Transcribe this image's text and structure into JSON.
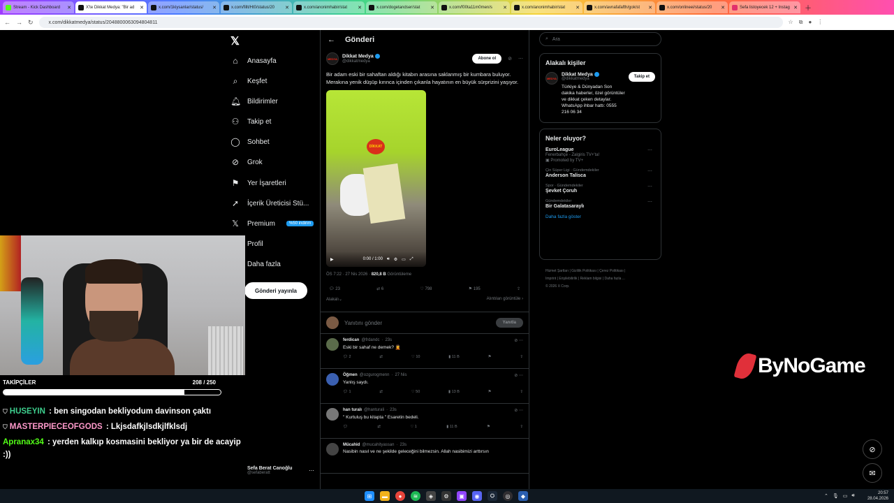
{
  "browser": {
    "tabs": [
      {
        "label": "Stream - Kick Dashboard",
        "color": "#53fc18"
      },
      {
        "label": "X'te Dikkat Medya: \"Bir ad",
        "color": "#111111"
      },
      {
        "label": "x.com/1kiysanlar/status/",
        "color": "#111111"
      },
      {
        "label": "x.com/fillt/Ht0/status/20",
        "color": "#111111"
      },
      {
        "label": "x.com/anonimhabir/stat",
        "color": "#111111"
      },
      {
        "label": "x.com/dogetandser/stat",
        "color": "#111111"
      },
      {
        "label": "x.com/f00ta11m0men/s",
        "color": "#111111"
      },
      {
        "label": "x.com/anonimhabir/stat",
        "color": "#111111"
      },
      {
        "label": "x.com/avnafafafth/gok/st",
        "color": "#111111"
      },
      {
        "label": "x.com/onlineei/status/20",
        "color": "#111111"
      },
      {
        "label": "Sefa listoyecek 12 + Instag",
        "color": "#e1306c"
      }
    ],
    "url": "x.com/dikkatmedya/status/2048800063094804811"
  },
  "nav": {
    "items": [
      {
        "label": "Anasayfa",
        "icon": "home-icon"
      },
      {
        "label": "Keşfet",
        "icon": "search-icon"
      },
      {
        "label": "Bildirimler",
        "icon": "bell-icon"
      },
      {
        "label": "Takip et",
        "icon": "person-plus-icon"
      },
      {
        "label": "Sohbet",
        "icon": "chat-icon"
      },
      {
        "label": "Grok",
        "icon": "grok-icon"
      },
      {
        "label": "Yer İşaretleri",
        "icon": "bookmark-icon"
      },
      {
        "label": "İçerik Üreticisi Stü...",
        "icon": "rocket-icon"
      },
      {
        "label": "Premium",
        "icon": "x-icon"
      },
      {
        "label": "Profil",
        "icon": "person-icon"
      },
      {
        "label": "Daha fazla",
        "icon": "more-icon"
      }
    ],
    "premium_badge": "%50 indirim",
    "post_button": "Gönderi yayınla",
    "profile": {
      "name": "Sefa Berat Canoğlu",
      "handle": "@sefaberatt"
    }
  },
  "main": {
    "title": "Gönderi",
    "post": {
      "author_name": "Dikkat Medya",
      "author_handle": "@dikkatmedya",
      "subscribe": "Abone ol",
      "text": "Bir adam eski bir sahaftan aldığı kitabın arasına saklanmış bir kumbara buluyor. Merakına yenik düşüp kırınca içinden çıkanla hayatının en büyük sürprizini yaşıyor.",
      "video_time": "0:00 / 1:00",
      "meta_time": "ÖS 7:22 · 27 Nis 2026 · ",
      "views": "820,8 B",
      "views_label": "Görüntüleme",
      "stats": {
        "replies": "23",
        "reposts": "6",
        "likes": "798",
        "bookmarks": "195"
      },
      "relevant_label": "Alakalı",
      "quotes_label": "Alıntıları görüntüle"
    },
    "reply_placeholder": "Yanıtını gönder",
    "reply_button": "Yanıtla",
    "comments": [
      {
        "name": "ferdican",
        "handle": "@frdandc",
        "time": "23s",
        "text": "Eski bir sahaf ne demek? 🤦",
        "replies": "2",
        "reposts": "",
        "likes": "10",
        "views": "11 B",
        "avatar_color": "#5a6b4a"
      },
      {
        "name": "Öğmen",
        "handle": "@ozgurogmenn",
        "time": "27 Nis",
        "text": "Yanlış saydı.",
        "replies": "1",
        "reposts": "",
        "likes": "50",
        "views": "13 B",
        "avatar_color": "#3a5fb0"
      },
      {
        "name": "han turalı",
        "handle": "@hanturali",
        "time": "23s",
        "text": "\" Kurtuluş bu kitapta \" Esaretin bedeli.",
        "replies": "",
        "reposts": "",
        "likes": "1",
        "views": "11 B",
        "avatar_color": "#777777"
      },
      {
        "name": "Mücahid",
        "handle": "@mucahityassan",
        "time": "23s",
        "text": "Nasibin nasıl ve ne şekilde geleceğini bilmezsin. Allah nasibimizi arttırsın",
        "replies": "",
        "reposts": "",
        "likes": "",
        "views": "",
        "avatar_color": "#444444"
      }
    ]
  },
  "right": {
    "search_placeholder": "Ara",
    "related_title": "Alakalı kişiler",
    "related": {
      "name": "Dikkat Medya",
      "handle": "@dikkatmedya",
      "follow": "Takip et",
      "bio": "Türkiye & Dünyadan Son dakika haberler, özel görüntüler ve dikkat çeken detaylar. WhatsApp ihbar hattı: 0555 216 06 34"
    },
    "trends_title": "Neler oluyor?",
    "trends": [
      {
        "cat": "",
        "title": "EuroLeague",
        "sub": "Fenerbahçe - Zalgiris TV+'ta!",
        "promo": "Promoted by TV+"
      },
      {
        "cat": "Çin Süper Ligi · Gündemdekiler",
        "title": "Anderson Talisca",
        "sub": "",
        "promo": ""
      },
      {
        "cat": "Spor · Gündemdekiler",
        "title": "Şevket Çoruh",
        "sub": "",
        "promo": ""
      },
      {
        "cat": "Gündemdekiler",
        "title": "Bir Galatasaraylı",
        "sub": "",
        "promo": ""
      }
    ],
    "show_more": "Daha fazla göster",
    "footer": [
      "Hizmet Şartları",
      "Gizlilik Politikası",
      "Çerez Politikası",
      "Imprint",
      "Erişilebilirlik",
      "Reklam bilgisi",
      "Daha fazla ...",
      "© 2026 X Corp."
    ]
  },
  "stream": {
    "followers_label": "TAKİPÇİLER",
    "followers_count": "208 / 250",
    "followers_progress": 0.832,
    "chat": [
      {
        "user": "HUSEYIN",
        "color": "#3ecf8e",
        "badge": true,
        "text": " : ben singodan bekliyodum davinson çaktı"
      },
      {
        "user": "MASTERPIECEOFGODS",
        "color": "#ff9acb",
        "badge": true,
        "text": " : Lkjsdafkjlsdkjlfklsdj"
      },
      {
        "user": "Apranax34",
        "color": "#53fc18",
        "badge": false,
        "text": " : yerden kalkıp kosmasini bekliyor ya bir de acayip :))"
      }
    ],
    "brand": "ByNoGame"
  },
  "taskbar": {
    "time": "20:57",
    "date": "28.04.2026"
  }
}
